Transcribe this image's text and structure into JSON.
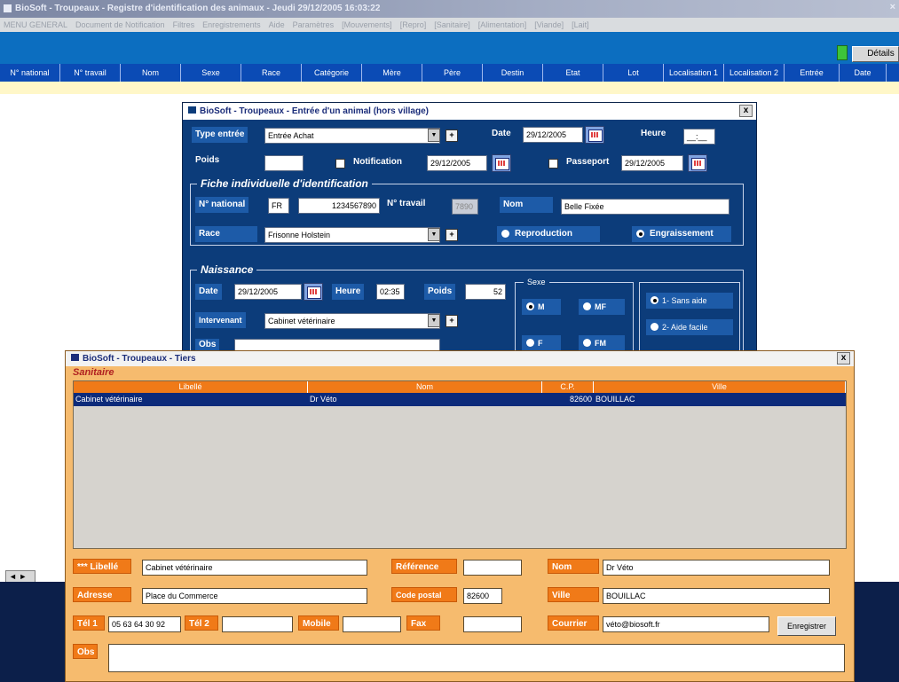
{
  "app": {
    "title": "BioSoft - Troupeaux - Registre d'identification des animaux - Jeudi 29/12/2005 16:03:22",
    "close_glyph": "×",
    "menu": [
      "MENU GENERAL",
      "Document de Notification",
      "Filtres",
      "Enregistrements",
      "Aide",
      "Paramètres",
      "[Mouvements]",
      "[Repro]",
      "[Sanitaire]",
      "[Alimentation]",
      "[Viande]",
      "[Lait]"
    ],
    "details_label": "Détails",
    "columns": [
      "N° national",
      "N° travail",
      "Nom",
      "Sexe",
      "Race",
      "Catégorie",
      "Mère",
      "Père",
      "Destin",
      "Etat",
      "Lot",
      "Localisation 1",
      "Localisation 2",
      "Entrée",
      "Date"
    ],
    "scroll_glyph": "◄ ►"
  },
  "entry_dialog": {
    "title": "BioSoft - Troupeaux - Entrée d'un animal (hors village)",
    "close": "x",
    "type_entree_label": "Type entrée",
    "type_entree_value": "Entrée Achat",
    "date_label": "Date",
    "date_value": "29/12/2005",
    "heure_label": "Heure",
    "heure_value": "__:__",
    "poids_label": "Poids",
    "poids_value": "",
    "notification_label": "Notification",
    "notification_date": "29/12/2005",
    "passeport_label": "Passeport",
    "passeport_date": "29/12/2005",
    "fiche_title": "Fiche individuelle d'identification",
    "n_national_label": "N° national",
    "country_code": "FR",
    "n_national_value": "1234567890",
    "n_travail_label": "N° travail",
    "n_travail_value": "7890",
    "nom_label": "Nom",
    "nom_value": "Belle Fixée",
    "race_label": "Race",
    "race_value": "Frisonne Holstein",
    "reproduction_label": "Reproduction",
    "engraissement_label": "Engraissement",
    "naissance_title": "Naissance",
    "naissance_date_label": "Date",
    "naissance_date_value": "29/12/2005",
    "naissance_heure_label": "Heure",
    "naissance_heure_value": "02:35",
    "naissance_poids_label": "Poids",
    "naissance_poids_value": "52",
    "sexe_title": "Sexe",
    "sexe_options": [
      "M",
      "MF",
      "F",
      "FM"
    ],
    "intervenant_label": "Intervenant",
    "intervenant_value": "Cabinet vétérinaire",
    "obs_label": "Obs",
    "velage_options": [
      "1- Sans aide",
      "2- Aide facile"
    ],
    "plus": "+",
    "dropdown_glyph": "▼"
  },
  "tiers_dialog": {
    "title": "BioSoft - Troupeaux - Tiers",
    "close": "x",
    "section": "Sanitaire",
    "columns": [
      "Libellé",
      "Nom",
      "C.P.",
      "Ville"
    ],
    "rows": [
      {
        "libelle": "Cabinet vétérinaire",
        "nom": "Dr Véto",
        "cp": "82600",
        "ville": "BOUILLAC"
      }
    ],
    "libelle_label": "*** Libellé",
    "libelle_value": "Cabinet vétérinaire",
    "reference_label": "Référence",
    "reference_value": "",
    "nom_label": "Nom",
    "nom_value": "Dr Véto",
    "adresse_label": "Adresse",
    "adresse_value": "Place du Commerce",
    "cp_label": "Code postal",
    "cp_value": "82600",
    "ville_label": "Ville",
    "ville_value": "BOUILLAC",
    "tel1_label": "Tél 1",
    "tel1_value": "05 63 64 30 92",
    "tel2_label": "Tél 2",
    "tel2_value": "",
    "mobile_label": "Mobile",
    "mobile_value": "",
    "fax_label": "Fax",
    "fax_value": "",
    "courrier_label": "Courrier",
    "courrier_value": "véto@biosoft.fr",
    "save_label": "Enregistrer",
    "obs_label": "Obs",
    "obs_value": ""
  },
  "colors": {
    "app_blue": "#0c6ec0",
    "grid_header": "#0b4bb5",
    "entry_dialog_bg": "#0c3c7a",
    "tiers_dialog_bg": "#f6bb6e",
    "tiers_accent": "#f07a18",
    "selected_row": "#0c2a7a"
  }
}
